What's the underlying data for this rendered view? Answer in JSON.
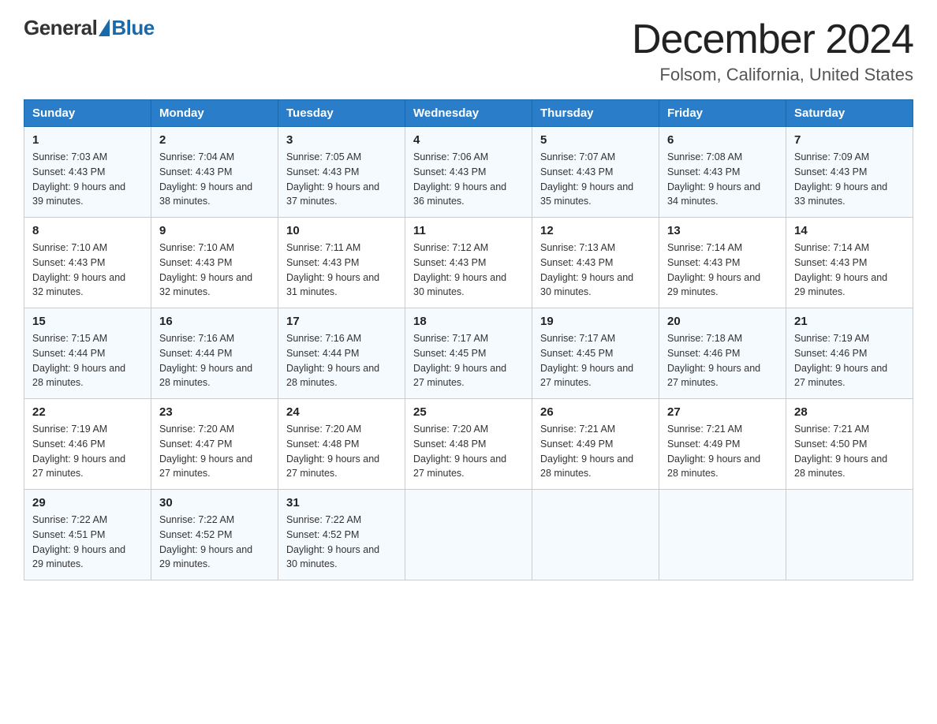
{
  "header": {
    "logo_general": "General",
    "logo_blue": "Blue",
    "month_title": "December 2024",
    "location": "Folsom, California, United States"
  },
  "days_of_week": [
    "Sunday",
    "Monday",
    "Tuesday",
    "Wednesday",
    "Thursday",
    "Friday",
    "Saturday"
  ],
  "weeks": [
    [
      {
        "day": "1",
        "sunrise": "7:03 AM",
        "sunset": "4:43 PM",
        "daylight": "9 hours and 39 minutes."
      },
      {
        "day": "2",
        "sunrise": "7:04 AM",
        "sunset": "4:43 PM",
        "daylight": "9 hours and 38 minutes."
      },
      {
        "day": "3",
        "sunrise": "7:05 AM",
        "sunset": "4:43 PM",
        "daylight": "9 hours and 37 minutes."
      },
      {
        "day": "4",
        "sunrise": "7:06 AM",
        "sunset": "4:43 PM",
        "daylight": "9 hours and 36 minutes."
      },
      {
        "day": "5",
        "sunrise": "7:07 AM",
        "sunset": "4:43 PM",
        "daylight": "9 hours and 35 minutes."
      },
      {
        "day": "6",
        "sunrise": "7:08 AM",
        "sunset": "4:43 PM",
        "daylight": "9 hours and 34 minutes."
      },
      {
        "day": "7",
        "sunrise": "7:09 AM",
        "sunset": "4:43 PM",
        "daylight": "9 hours and 33 minutes."
      }
    ],
    [
      {
        "day": "8",
        "sunrise": "7:10 AM",
        "sunset": "4:43 PM",
        "daylight": "9 hours and 32 minutes."
      },
      {
        "day": "9",
        "sunrise": "7:10 AM",
        "sunset": "4:43 PM",
        "daylight": "9 hours and 32 minutes."
      },
      {
        "day": "10",
        "sunrise": "7:11 AM",
        "sunset": "4:43 PM",
        "daylight": "9 hours and 31 minutes."
      },
      {
        "day": "11",
        "sunrise": "7:12 AM",
        "sunset": "4:43 PM",
        "daylight": "9 hours and 30 minutes."
      },
      {
        "day": "12",
        "sunrise": "7:13 AM",
        "sunset": "4:43 PM",
        "daylight": "9 hours and 30 minutes."
      },
      {
        "day": "13",
        "sunrise": "7:14 AM",
        "sunset": "4:43 PM",
        "daylight": "9 hours and 29 minutes."
      },
      {
        "day": "14",
        "sunrise": "7:14 AM",
        "sunset": "4:43 PM",
        "daylight": "9 hours and 29 minutes."
      }
    ],
    [
      {
        "day": "15",
        "sunrise": "7:15 AM",
        "sunset": "4:44 PM",
        "daylight": "9 hours and 28 minutes."
      },
      {
        "day": "16",
        "sunrise": "7:16 AM",
        "sunset": "4:44 PM",
        "daylight": "9 hours and 28 minutes."
      },
      {
        "day": "17",
        "sunrise": "7:16 AM",
        "sunset": "4:44 PM",
        "daylight": "9 hours and 28 minutes."
      },
      {
        "day": "18",
        "sunrise": "7:17 AM",
        "sunset": "4:45 PM",
        "daylight": "9 hours and 27 minutes."
      },
      {
        "day": "19",
        "sunrise": "7:17 AM",
        "sunset": "4:45 PM",
        "daylight": "9 hours and 27 minutes."
      },
      {
        "day": "20",
        "sunrise": "7:18 AM",
        "sunset": "4:46 PM",
        "daylight": "9 hours and 27 minutes."
      },
      {
        "day": "21",
        "sunrise": "7:19 AM",
        "sunset": "4:46 PM",
        "daylight": "9 hours and 27 minutes."
      }
    ],
    [
      {
        "day": "22",
        "sunrise": "7:19 AM",
        "sunset": "4:46 PM",
        "daylight": "9 hours and 27 minutes."
      },
      {
        "day": "23",
        "sunrise": "7:20 AM",
        "sunset": "4:47 PM",
        "daylight": "9 hours and 27 minutes."
      },
      {
        "day": "24",
        "sunrise": "7:20 AM",
        "sunset": "4:48 PM",
        "daylight": "9 hours and 27 minutes."
      },
      {
        "day": "25",
        "sunrise": "7:20 AM",
        "sunset": "4:48 PM",
        "daylight": "9 hours and 27 minutes."
      },
      {
        "day": "26",
        "sunrise": "7:21 AM",
        "sunset": "4:49 PM",
        "daylight": "9 hours and 28 minutes."
      },
      {
        "day": "27",
        "sunrise": "7:21 AM",
        "sunset": "4:49 PM",
        "daylight": "9 hours and 28 minutes."
      },
      {
        "day": "28",
        "sunrise": "7:21 AM",
        "sunset": "4:50 PM",
        "daylight": "9 hours and 28 minutes."
      }
    ],
    [
      {
        "day": "29",
        "sunrise": "7:22 AM",
        "sunset": "4:51 PM",
        "daylight": "9 hours and 29 minutes."
      },
      {
        "day": "30",
        "sunrise": "7:22 AM",
        "sunset": "4:52 PM",
        "daylight": "9 hours and 29 minutes."
      },
      {
        "day": "31",
        "sunrise": "7:22 AM",
        "sunset": "4:52 PM",
        "daylight": "9 hours and 30 minutes."
      },
      null,
      null,
      null,
      null
    ]
  ],
  "labels": {
    "sunrise_prefix": "Sunrise: ",
    "sunset_prefix": "Sunset: ",
    "daylight_prefix": "Daylight: "
  }
}
